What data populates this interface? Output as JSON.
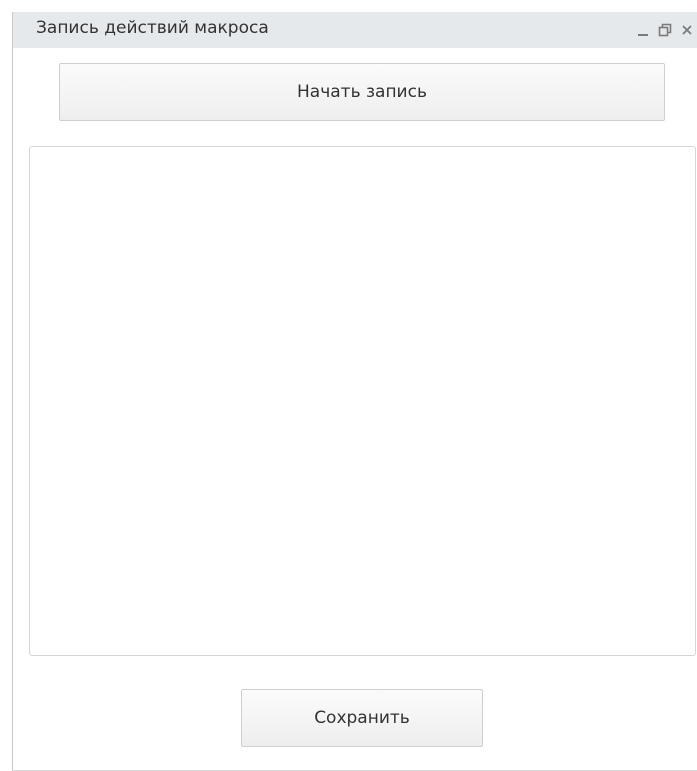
{
  "window": {
    "title": "Запись действий макроса"
  },
  "controls": {
    "minimize_icon": "minimize-icon",
    "restore_icon": "restore-icon",
    "close_icon": "close-icon"
  },
  "actions": {
    "start_recording_label": "Начать запись",
    "save_label": "Сохранить"
  },
  "log": {
    "content": ""
  },
  "colors": {
    "titlebar": "#e6e9ec",
    "button_border": "#cfcfcf",
    "text": "#333333"
  }
}
